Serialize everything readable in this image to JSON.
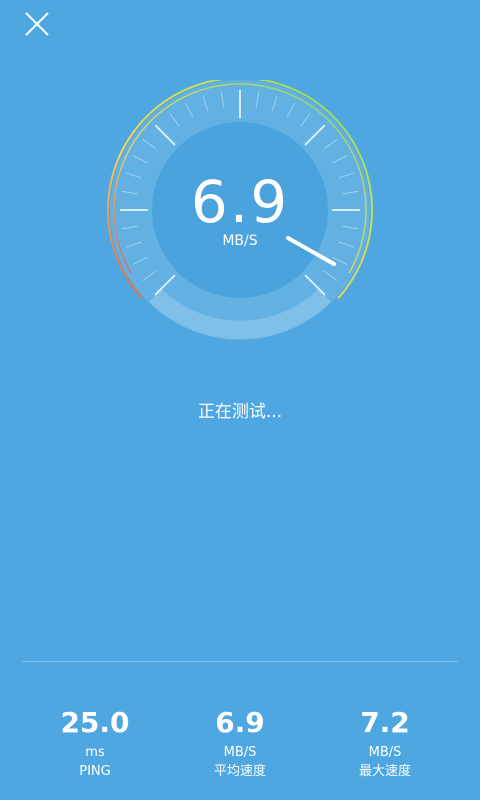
{
  "header": {
    "close_icon": "close-icon"
  },
  "gauge": {
    "value": "6.9",
    "unit": "MB/S",
    "needle_icon": "needle"
  },
  "status": {
    "text": "正在测试..."
  },
  "stats": [
    {
      "value": "25.0",
      "unit": "ms",
      "label": "PING"
    },
    {
      "value": "6.9",
      "unit": "MB/S",
      "label": "平均速度"
    },
    {
      "value": "7.2",
      "unit": "MB/S",
      "label": "最大速度"
    }
  ],
  "colors": {
    "background": "#4ea7e0",
    "arc_red": "#e8584a",
    "arc_yellow": "#f3d55a",
    "arc_green": "#6fd36a"
  }
}
